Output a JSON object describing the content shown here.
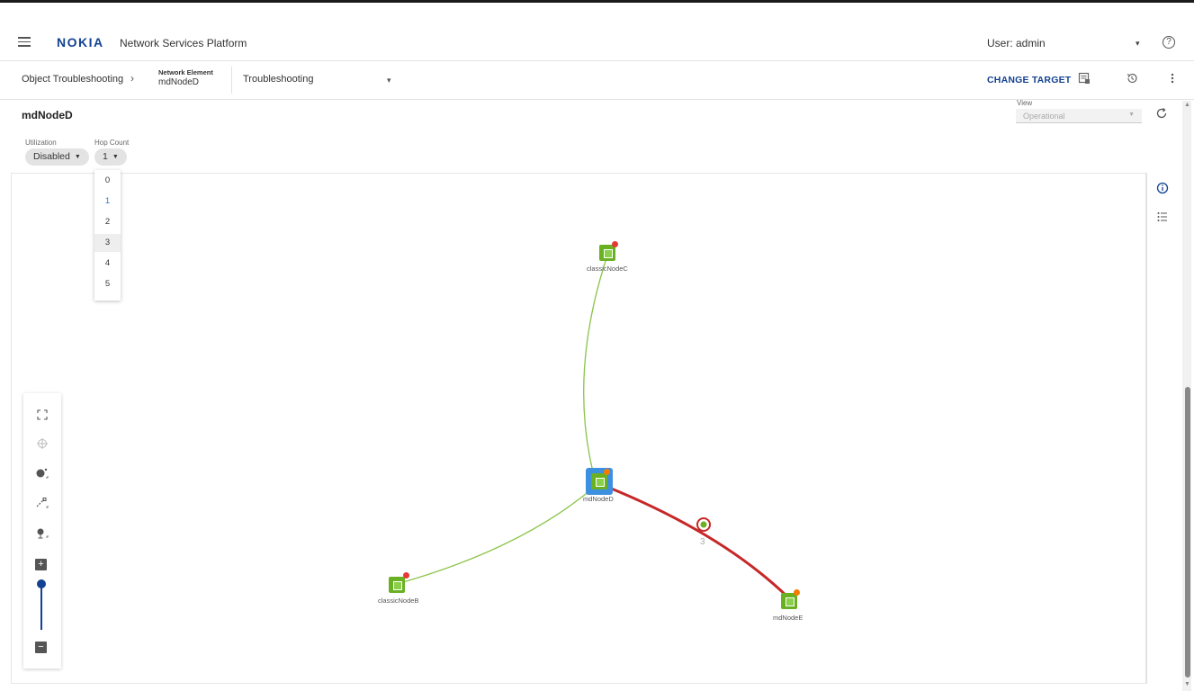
{
  "header": {
    "logo": "NOKIA",
    "app_title": "Network Services Platform",
    "user": "User: admin",
    "user_caret": "▾",
    "help": "?"
  },
  "toolbar": {
    "breadcrumb_root": "Object Troubleshooting",
    "separator": "›",
    "target_type_label": "Network Element",
    "target_name": "mdNodeD",
    "view_select": "Troubleshooting",
    "view_select_caret": "▾",
    "change_target": "CHANGE TARGET"
  },
  "panel": {
    "title": "mdNodeD",
    "view_label": "View",
    "view_value": "Operational",
    "filters": {
      "utilization_label": "Utilization",
      "utilization_value": "Disabled",
      "hop_count_label": "Hop Count",
      "hop_count_value": "1"
    },
    "hop_count_options": [
      "0",
      "1",
      "2",
      "3",
      "4",
      "5"
    ],
    "hop_count_selected": "1",
    "hop_count_hovered": "3"
  },
  "topology": {
    "nodes": [
      {
        "name": "classicNodeC",
        "alarm_color": "#e53935"
      },
      {
        "name": "mdNodeD",
        "alarm_color": "#f57c00",
        "focused": true
      },
      {
        "name": "classicNodeB",
        "alarm_color": "#e53935"
      },
      {
        "name": "mdNodeE",
        "alarm_color": "#f57c00"
      }
    ],
    "links": [
      {
        "from": "mdNodeD",
        "to": "classicNodeC",
        "color": "#8bc34a"
      },
      {
        "from": "mdNodeD",
        "to": "classicNodeB",
        "color": "#8bc34a"
      },
      {
        "from": "mdNodeD",
        "to": "mdNodeE",
        "color": "#c62828",
        "aggregate_count": "3"
      }
    ]
  },
  "colors": {
    "brand": "#124191",
    "node_green": "#6ab023",
    "focus_blue": "#3d8fe0",
    "link_red": "#c62828",
    "link_green": "#8bc34a"
  },
  "icons": {
    "menu": "hamburger-icon",
    "help": "help-icon",
    "doc": "document-icon",
    "history": "history-icon",
    "more": "more-vertical-icon",
    "refresh": "refresh-icon",
    "info": "info-icon",
    "list": "list-icon",
    "fit": "fit-to-screen-icon",
    "crosshair": "crosshair-icon",
    "node_tool": "node-tool-icon",
    "link_tool": "link-tool-icon",
    "globe_tool": "globe-tool-icon",
    "zoom_in": "zoom-in-icon",
    "zoom_out": "zoom-out-icon"
  }
}
